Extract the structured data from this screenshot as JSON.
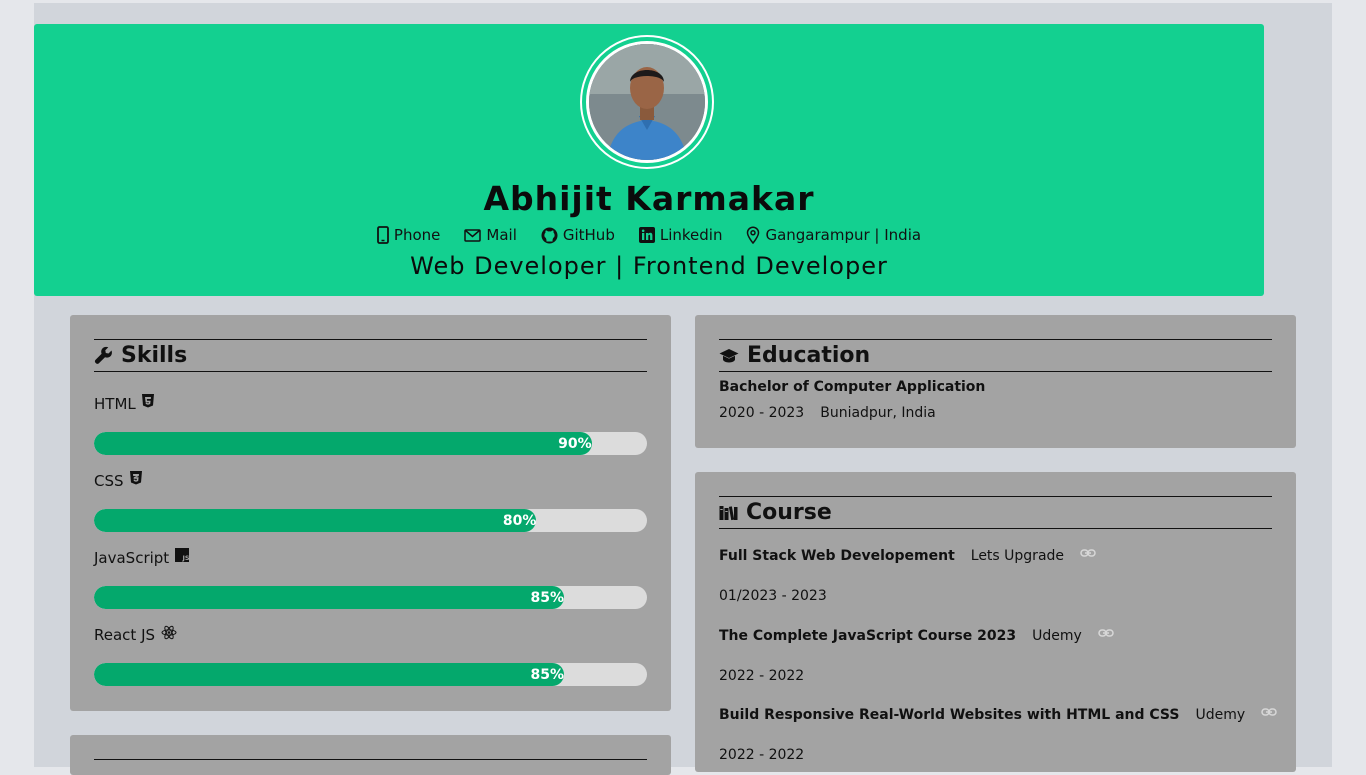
{
  "header": {
    "name": "Abhijit Karmakar",
    "role": "Web Developer | Frontend Developer",
    "contacts": [
      {
        "label": "Phone",
        "icon": "phone-icon"
      },
      {
        "label": "Mail",
        "icon": "mail-icon"
      },
      {
        "label": "GitHub",
        "icon": "github-icon"
      },
      {
        "label": "Linkedin",
        "icon": "linkedin-icon"
      },
      {
        "label": "Gangarampur | India",
        "icon": "location-icon"
      }
    ]
  },
  "skills": {
    "title": "Skills",
    "items": [
      {
        "label": "HTML",
        "percent": 90,
        "percent_label": "90%",
        "icon": "html5-icon"
      },
      {
        "label": "CSS",
        "percent": 80,
        "percent_label": "80%",
        "icon": "css3-icon"
      },
      {
        "label": "JavaScript",
        "percent": 85,
        "percent_label": "85%",
        "icon": "js-icon"
      },
      {
        "label": "React JS",
        "percent": 85,
        "percent_label": "85%",
        "icon": "react-icon"
      }
    ]
  },
  "education": {
    "title": "Education",
    "degree": "Bachelor of Computer Application",
    "years": "2020 - 2023",
    "location": "Buniadpur, India"
  },
  "course": {
    "title": "Course",
    "items": [
      {
        "name": "Full Stack Web Developement",
        "provider": "Lets Upgrade",
        "dates": "01/2023 - 2023"
      },
      {
        "name": "The Complete JavaScript Course 2023",
        "provider": "Udemy",
        "dates": "2022 - 2022"
      },
      {
        "name": "Build Responsive Real-World Websites with HTML and CSS",
        "provider": "Udemy",
        "dates": "2022 - 2022"
      }
    ]
  },
  "colors": {
    "accent": "#13d090",
    "bar_fill": "#04a86c",
    "card": "#a3a3a3",
    "page_bg": "#d1d5db"
  }
}
